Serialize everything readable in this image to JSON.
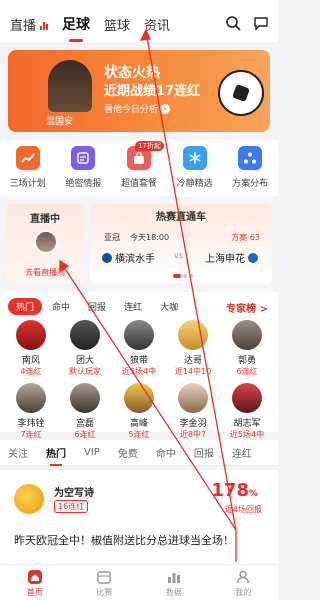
{
  "topnav": {
    "tabs": [
      {
        "label": "直播"
      },
      {
        "label": "足球"
      },
      {
        "label": "篮球"
      },
      {
        "label": "资讯"
      }
    ],
    "active": "足球"
  },
  "banner": {
    "person_name": "温国安",
    "line1": "状态火热",
    "line2": "近期战绩17连红",
    "line3": "看他今日分析"
  },
  "quick_menu": [
    {
      "label": "三场计划",
      "icon": "trend-icon",
      "color": "#f26a2b"
    },
    {
      "label": "绝密情报",
      "icon": "list-icon",
      "color": "#7b5cf0"
    },
    {
      "label": "超值套餐",
      "icon": "bag-icon",
      "color": "#f05a5a",
      "badge": "17折起"
    },
    {
      "label": "冷静精选",
      "icon": "snowflake-icon",
      "color": "#3aa0f2"
    },
    {
      "label": "方案分布",
      "icon": "network-icon",
      "color": "#3a7bf2"
    }
  ],
  "live": {
    "title": "直播中",
    "link": "去看直播间"
  },
  "hot_match": {
    "title": "热赛直通车",
    "league": "亚冠",
    "time": "今天18:00",
    "plans": "方案 63",
    "home": "横滨水手",
    "vs": "vs",
    "away": "上海申花",
    "colors": {
      "home": "#1a4fa0",
      "away": "#1f66c8"
    }
  },
  "expert": {
    "filter_tabs": [
      "热门",
      "命中",
      "回报",
      "连红",
      "大咖"
    ],
    "active_filter": "热门",
    "more_label": "专家榜 >",
    "row1": [
      {
        "name": "南风",
        "stat": "4连红"
      },
      {
        "name": "团大",
        "stat": "默认玩家"
      },
      {
        "name": "狼带",
        "stat": "近5场4中"
      },
      {
        "name": "达哥",
        "stat": "近14中10"
      },
      {
        "name": "郭勇",
        "stat": "6连红"
      }
    ],
    "row2": [
      {
        "name": "李玮铨",
        "stat": "7连红"
      },
      {
        "name": "宫磊",
        "stat": "6连红"
      },
      {
        "name": "高峰",
        "stat": "5连红"
      },
      {
        "name": "李金羽",
        "stat": "近8中7"
      },
      {
        "name": "胡志军",
        "stat": "近5场4中"
      }
    ]
  },
  "content_tabs": [
    "关注",
    "热门",
    "VIP",
    "免费",
    "命中",
    "回报",
    "连红"
  ],
  "active_content_tab": "热门",
  "article": {
    "author": "为空写诗",
    "tag": "16连红",
    "percent": "178",
    "percent_unit": "%",
    "sub": "近4场回报",
    "title": "昨天欧冠全中！椒值附送比分总进球当全场！"
  },
  "bottom_nav": [
    {
      "label": "首页",
      "icon": "home-icon"
    },
    {
      "label": "比赛",
      "icon": "schedule-icon"
    },
    {
      "label": "数据",
      "icon": "data-icon"
    },
    {
      "label": "我的",
      "icon": "profile-icon"
    }
  ],
  "active_bottom": "首页"
}
